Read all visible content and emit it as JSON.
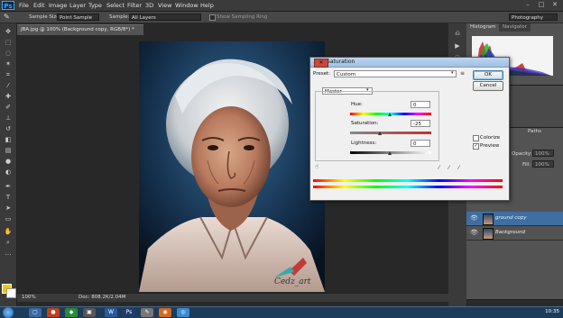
{
  "app": {
    "logo": "Ps"
  },
  "menu": [
    "File",
    "Edit",
    "Image",
    "Layer",
    "Type",
    "Select",
    "Filter",
    "3D",
    "View",
    "Window",
    "Help"
  ],
  "window_controls": [
    "–",
    "□",
    "✕"
  ],
  "options_bar": {
    "sample_size_label": "Sample Size:",
    "sample_size_value": "Point Sample",
    "sample_label": "Sample:",
    "sample_value": "All Layers",
    "show_ring_label": "Show Sampling Ring",
    "workspace": "Photography"
  },
  "document": {
    "tab_title": "JBA.jpg @ 100% (Background copy, RGB/8*) *",
    "zoom": "100%",
    "doc_info": "Doc: 808.2K/2.04M"
  },
  "photo": {
    "watermark": "Cedz_art"
  },
  "panels": {
    "histogram_tab": "Histogram",
    "navigator_tab": "Navigator",
    "paths_tab": "Paths",
    "opacity_label": "Opacity:",
    "opacity_value": "100%",
    "fill_label": "Fill:",
    "fill_value": "100%"
  },
  "layers": [
    {
      "name": "Background copy",
      "display": "ground copy"
    },
    {
      "name": "Background",
      "display": "Background"
    }
  ],
  "dialog": {
    "title": "Hue/Saturation",
    "preset_label": "Preset:",
    "preset_value": "Custom",
    "channel_value": "Master",
    "hue_label": "Hue:",
    "hue_value": "0",
    "saturation_label": "Saturation:",
    "saturation_value": "-25",
    "lightness_label": "Lightness:",
    "lightness_value": "0",
    "ok_label": "OK",
    "cancel_label": "Cancel",
    "colorize_label": "Colorize",
    "preview_label": "Preview",
    "preview_checked": true,
    "colorize_checked": false
  },
  "taskbar": {
    "clock": "10:35"
  }
}
